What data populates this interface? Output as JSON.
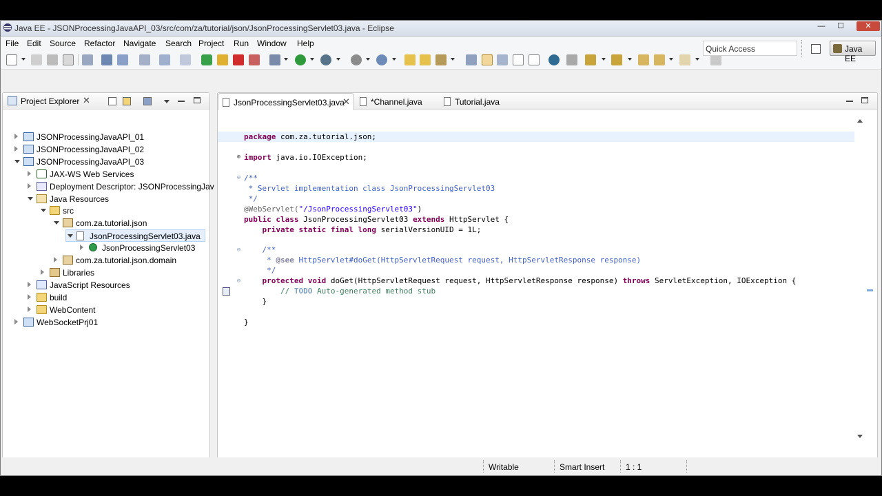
{
  "window": {
    "title": "Java EE - JSONProcessingJavaAPI_03/src/com/za/tutorial/json/JsonProcessingServlet03.java - Eclipse",
    "controls": {
      "minimize": "—",
      "maximize": "☐",
      "close": "✕"
    }
  },
  "menu": [
    "File",
    "Edit",
    "Source",
    "Refactor",
    "Navigate",
    "Search",
    "Project",
    "Run",
    "Window",
    "Help"
  ],
  "toolbar": {
    "quick_access": "Quick Access",
    "perspective": "Java EE",
    "icons": [
      "new-icon",
      "save-icon",
      "save-all-icon",
      "print-icon",
      "debug-icon",
      "run-icon",
      "external-tools-icon",
      "search-icon",
      "back-icon",
      "forward-icon"
    ]
  },
  "explorer": {
    "title": "Project Explorer",
    "close": "✕",
    "tree": [
      {
        "label": "JSONProcessingJavaAPI_01",
        "icon": "project",
        "twisty": "closed"
      },
      {
        "label": "JSONProcessingJavaAPI_02",
        "icon": "project",
        "twisty": "closed"
      },
      {
        "label": "JSONProcessingJavaAPI_03",
        "icon": "project",
        "twisty": "open"
      },
      {
        "label": "JAX-WS Web Services",
        "icon": "ws",
        "twisty": "closed"
      },
      {
        "label": "Deployment Descriptor: JSONProcessingJav",
        "icon": "dd",
        "twisty": "closed"
      },
      {
        "label": "Java Resources",
        "icon": "jr",
        "twisty": "open"
      },
      {
        "label": "src",
        "icon": "folder",
        "twisty": "open"
      },
      {
        "label": "com.za.tutorial.json",
        "icon": "pkg",
        "twisty": "open"
      },
      {
        "label": "JsonProcessingServlet03.java",
        "icon": "java",
        "twisty": "open"
      },
      {
        "label": "JsonProcessingServlet03",
        "icon": "class",
        "twisty": "closed"
      },
      {
        "label": "com.za.tutorial.json.domain",
        "icon": "pkg",
        "twisty": "closed"
      },
      {
        "label": "Libraries",
        "icon": "lib",
        "twisty": "closed"
      },
      {
        "label": "JavaScript Resources",
        "icon": "js",
        "twisty": "closed"
      },
      {
        "label": "build",
        "icon": "folder",
        "twisty": "closed"
      },
      {
        "label": "WebContent",
        "icon": "folder",
        "twisty": "closed"
      },
      {
        "label": "WebSocketPrj01",
        "icon": "project",
        "twisty": "closed"
      }
    ]
  },
  "editor": {
    "tabs": [
      {
        "label": "JsonProcessingServlet03.java",
        "active": true,
        "close": "✕"
      },
      {
        "label": "*Channel.java",
        "active": false
      },
      {
        "label": "Tutorial.java",
        "active": false
      }
    ],
    "code": {
      "l1_kw": "package",
      "l1_rest": " com.za.tutorial.json;",
      "l2_kw": "import",
      "l2_rest": " java.io.IOException;",
      "l3": "/**",
      "l4": " * Servlet implementation class JsonProcessingServlet03",
      "l5": " */",
      "l6_ann": "@WebServlet(",
      "l6_str": "\"/JsonProcessingServlet03\"",
      "l6_end": ")",
      "l7_kw1": "public class",
      "l7_mid": " JsonProcessingServlet03 ",
      "l7_kw2": "extends",
      "l7_end": " HttpServlet {",
      "l8_kw": "    private static final long",
      "l8_rest": " serialVersionUID = 1L;",
      "l9": "    /**",
      "l10_a": "     * ",
      "l10_see": "@see",
      "l10_b": " HttpServlet#doGet(HttpServletRequest request, HttpServletResponse response)",
      "l11": "     */",
      "l12_kw": "    protected void",
      "l12_mid": " doGet(HttpServletRequest request, HttpServletResponse response) ",
      "l12_kw2": "throws",
      "l12_end": " ServletException, IOException {",
      "l13_a": "        // ",
      "l13_todo": "TODO",
      "l13_b": " Auto-generated method stub",
      "l14": "    }",
      "l15": "}"
    }
  },
  "status": {
    "writable": "Writable",
    "insert_mode": "Smart Insert",
    "position": "1 : 1"
  },
  "colors": {
    "keyword": "#7f0055",
    "comment": "#3f5fbf",
    "string": "#2a00ff"
  }
}
